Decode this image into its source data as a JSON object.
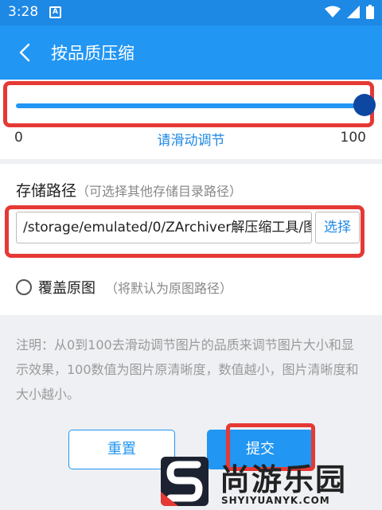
{
  "status_bar": {
    "time": "3:28",
    "notification_glyph": "A"
  },
  "app_bar": {
    "title": "按品质压缩",
    "back_icon": "chevron-left-icon"
  },
  "slider": {
    "min_label": "0",
    "max_label": "100",
    "hint": "请滑动调节",
    "value": 100,
    "min": 0,
    "max": 100
  },
  "storage": {
    "label": "存储路径",
    "label_hint": "（可选择其他存储目录路径）",
    "path_value": "/storage/emulated/0/ZArchiver解压缩工具/图",
    "select_button": "选择"
  },
  "overwrite": {
    "label": "覆盖原图",
    "hint": "（将默认为原图路径）",
    "checked": false
  },
  "note": "注明：从0到100去滑动调节图片的品质来调节图片大小和显示效果，100数值为图片原清晰度，数值越小，图片清晰度和大小越小。",
  "buttons": {
    "reset": "重置",
    "submit": "提交"
  },
  "watermark": {
    "title": "尚游乐园",
    "url": "SHYIYUANYK.COM"
  },
  "colors": {
    "primary": "#2196f3",
    "status_bar": "#1e88e5",
    "highlight": "#e53935",
    "thumb": "#0d47a1"
  }
}
